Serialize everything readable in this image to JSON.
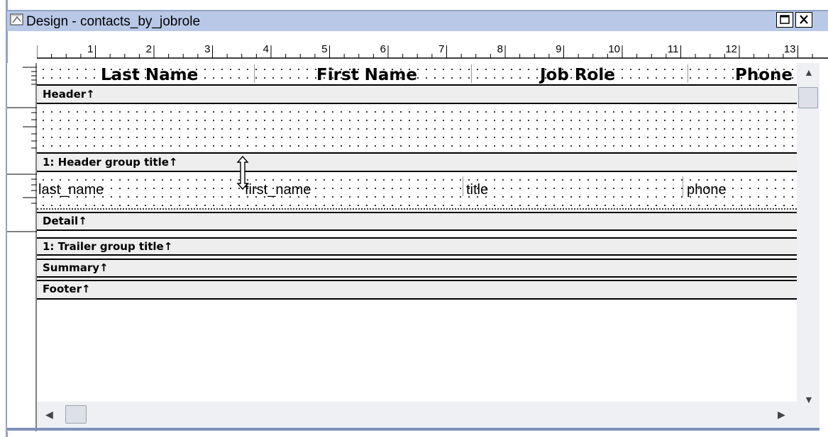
{
  "window": {
    "title": "Design - contacts_by_jobrole",
    "icon": "datawindow-design-icon",
    "maximize_icon": "maximize-icon",
    "close_icon": "close-icon"
  },
  "ruler": {
    "marks": [
      "1",
      "2",
      "3",
      "4",
      "5",
      "6",
      "7",
      "8",
      "9",
      "10",
      "11",
      "12",
      "13"
    ]
  },
  "headings": {
    "last_name": "Last Name",
    "first_name": "First Name",
    "job_role": "Job Role",
    "phone": "Phone"
  },
  "bands": {
    "header": "Header↑",
    "header_group": "1: Header group title↑",
    "detail": "Detail↑",
    "trailer_group": "1: Trailer group title↑",
    "summary": "Summary↑",
    "footer": "Footer↑"
  },
  "fields": {
    "last_name": "last_name",
    "first_name": "first_name",
    "title": "title",
    "phone": "phone"
  },
  "cursor": "resize-vertical-cursor-icon",
  "colors": {
    "titlebar": "#b9c8e6",
    "band": "#eeeeee",
    "frame": "#8ea3c9"
  }
}
